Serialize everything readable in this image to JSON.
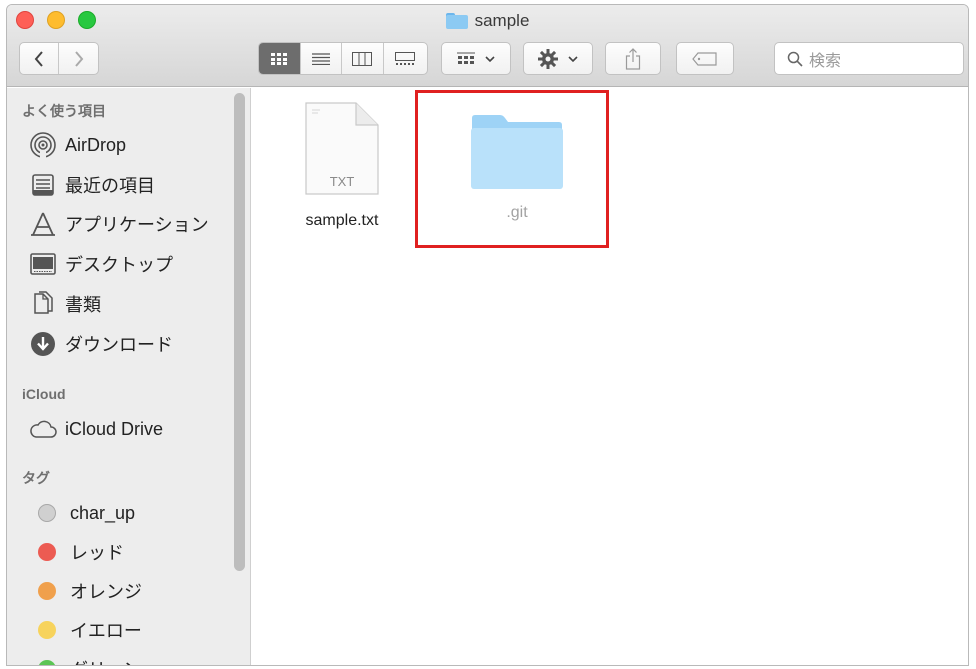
{
  "window": {
    "title": "sample",
    "search_placeholder": "検索"
  },
  "colors": {
    "folder": "#8ccaf3",
    "highlight": "#e02020",
    "tag_gray": "#d0d0d0",
    "tag_red": "#ec5b52",
    "tag_orange": "#f0a04c",
    "tag_yellow": "#f7d35c",
    "tag_green": "#5cc555"
  },
  "sidebar": {
    "favorites_header": "よく使う項目",
    "favorites": [
      {
        "label": "AirDrop",
        "icon": "airdrop-icon"
      },
      {
        "label": "最近の項目",
        "icon": "recents-icon"
      },
      {
        "label": "アプリケーション",
        "icon": "applications-icon"
      },
      {
        "label": "デスクトップ",
        "icon": "desktop-icon"
      },
      {
        "label": "書類",
        "icon": "documents-icon"
      },
      {
        "label": "ダウンロード",
        "icon": "downloads-icon"
      }
    ],
    "icloud_header": "iCloud",
    "icloud": [
      {
        "label": "iCloud Drive",
        "icon": "cloud-icon"
      }
    ],
    "tags_header": "タグ",
    "tags": [
      {
        "label": "char_up"
      },
      {
        "label": "レッド"
      },
      {
        "label": "オレンジ"
      },
      {
        "label": "イエロー"
      },
      {
        "label": "グリーン"
      }
    ]
  },
  "files": [
    {
      "name": "sample.txt",
      "badge": "TXT",
      "icon": "text-document-icon"
    },
    {
      "name": ".git",
      "icon": "folder-icon"
    }
  ]
}
